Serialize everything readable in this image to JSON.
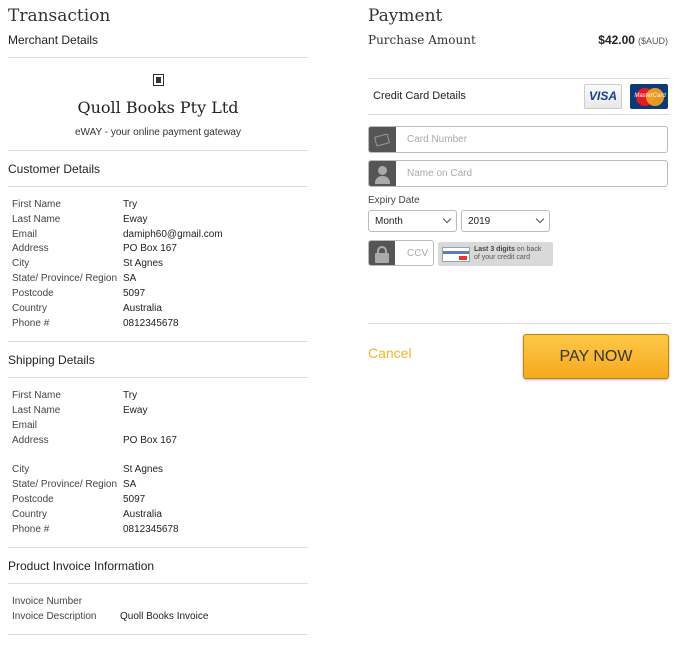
{
  "transaction": {
    "title": "Transaction",
    "merchant_details_heading": "Merchant Details",
    "merchant_name": "Quoll Books Pty Ltd",
    "gateway_tagline": "eWAY - your online payment gateway"
  },
  "customer": {
    "heading": "Customer Details",
    "rows": [
      {
        "label": "First Name",
        "value": "Try"
      },
      {
        "label": "Last Name",
        "value": "Eway"
      },
      {
        "label": "Email",
        "value": "damiph60@gmail.com"
      },
      {
        "label": "Address",
        "value": "PO Box 167"
      },
      {
        "label": "City",
        "value": "St Agnes"
      },
      {
        "label": "State/ Province/ Region",
        "value": "SA"
      },
      {
        "label": "Postcode",
        "value": "5097"
      },
      {
        "label": "Country",
        "value": "Australia"
      },
      {
        "label": "Phone #",
        "value": "0812345678"
      }
    ]
  },
  "shipping": {
    "heading": "Shipping Details",
    "rows": [
      {
        "label": "First Name",
        "value": "Try"
      },
      {
        "label": "Last Name",
        "value": "Eway"
      },
      {
        "label": "Email",
        "value": ""
      },
      {
        "label": "Address",
        "value": "PO Box 167"
      },
      {
        "label": "City",
        "value": "St Agnes"
      },
      {
        "label": "State/ Province/ Region",
        "value": "SA"
      },
      {
        "label": "Postcode",
        "value": "5097"
      },
      {
        "label": "Country",
        "value": "Australia"
      },
      {
        "label": "Phone #",
        "value": "0812345678"
      }
    ]
  },
  "invoice": {
    "heading": "Product Invoice Information",
    "rows": [
      {
        "label": "Invoice Number",
        "value": ""
      },
      {
        "label": "Invoice Description",
        "value": "Quoll Books Invoice"
      }
    ]
  },
  "payment": {
    "title": "Payment",
    "purchase_label": "Purchase Amount",
    "amount": "$42.00",
    "currency": "($AUD)",
    "cc_heading": "Credit Card Details",
    "visa_label": "VISA",
    "mastercard_label": "MasterCard",
    "card_number_placeholder": "Card Number",
    "name_placeholder": "Name on Card",
    "expiry_label": "Expiry Date",
    "month_selected": "Month",
    "year_selected": "2019",
    "ccv_placeholder": "CCV",
    "ccv_hint_bold": "Last 3 digits",
    "ccv_hint_rest_1": "on back",
    "ccv_hint_rest_2": "of your credit card",
    "cancel_label": "Cancel",
    "pay_label": "PAY NOW"
  },
  "colors": {
    "accent": "#f3b32b",
    "pay_button": "#fdc848",
    "icon_bg": "#555555"
  }
}
